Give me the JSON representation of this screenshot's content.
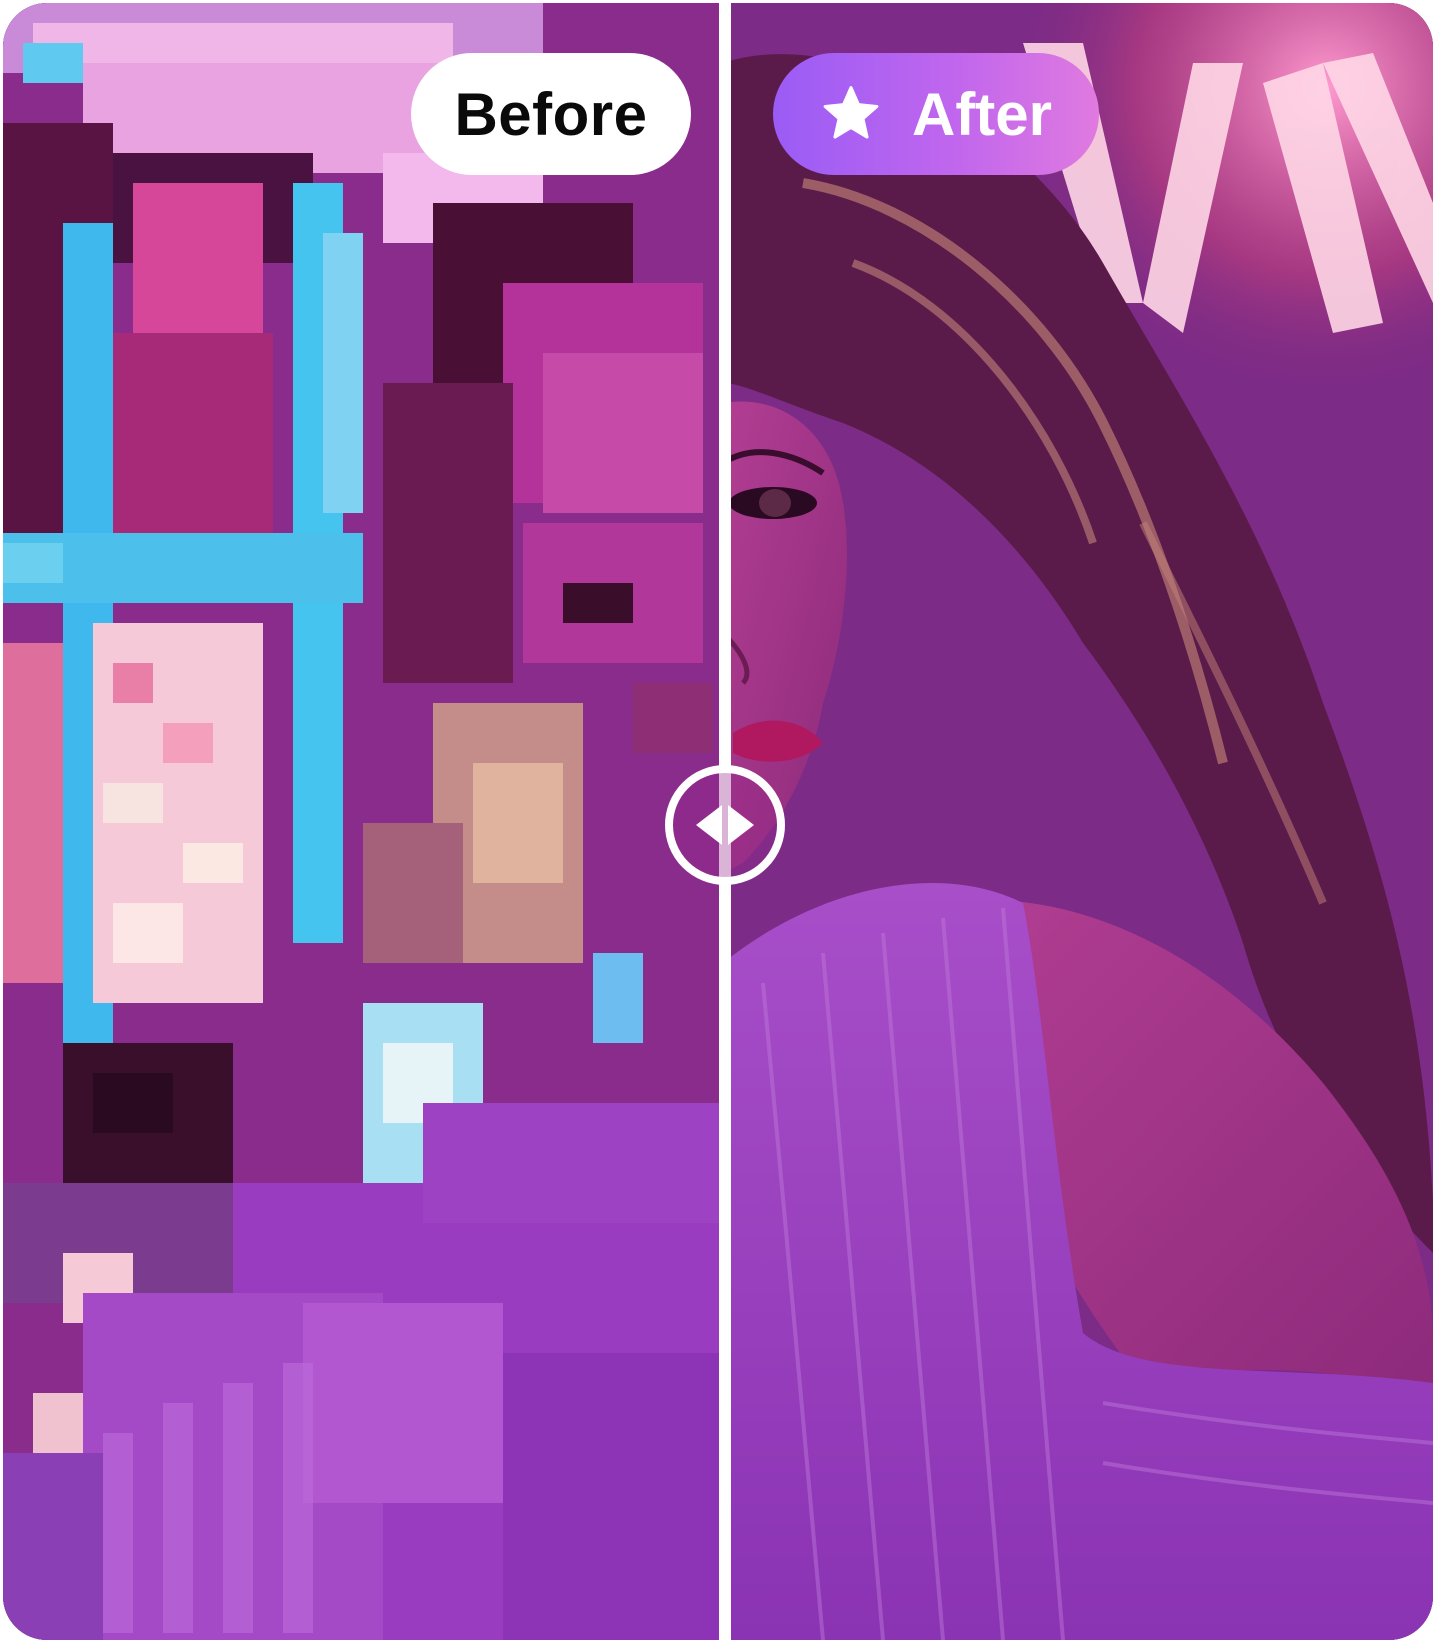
{
  "comparison": {
    "before_label": "Before",
    "after_label": "After",
    "icons": {
      "after_badge_icon": "star-icon",
      "handle_icon": "left-right-arrows-icon"
    },
    "colors": {
      "before_badge_bg": "#ffffff",
      "before_badge_text": "#0a0a0a",
      "after_badge_gradient_start": "#9a5cf5",
      "after_badge_gradient_end": "#e07ae0",
      "after_badge_text": "#ffffff",
      "divider": "#ffffff"
    }
  }
}
